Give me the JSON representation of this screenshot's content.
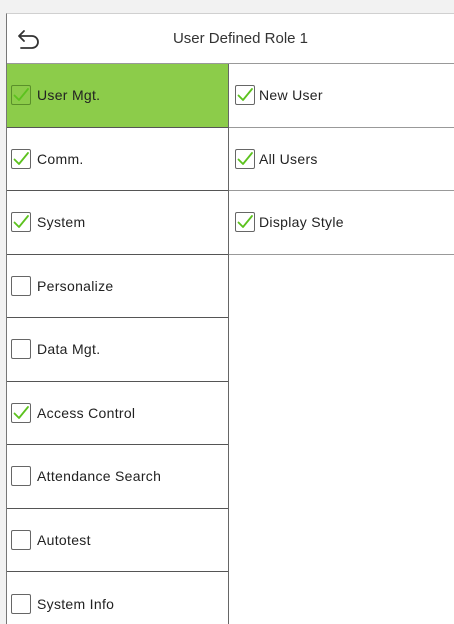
{
  "header": {
    "title": "User Defined Role 1",
    "back_icon": "back-arrow-icon"
  },
  "colors": {
    "selected_bg": "#8ccc4a",
    "check": "#5cc21e"
  },
  "left_menu": {
    "items": [
      {
        "label": "User Mgt.",
        "checked": true,
        "selected": true
      },
      {
        "label": "Comm.",
        "checked": true,
        "selected": false
      },
      {
        "label": "System",
        "checked": true,
        "selected": false
      },
      {
        "label": "Personalize",
        "checked": false,
        "selected": false
      },
      {
        "label": "Data Mgt.",
        "checked": false,
        "selected": false
      },
      {
        "label": "Access Control",
        "checked": true,
        "selected": false
      },
      {
        "label": "Attendance Search",
        "checked": false,
        "selected": false
      },
      {
        "label": "Autotest",
        "checked": false,
        "selected": false
      },
      {
        "label": "System Info",
        "checked": false,
        "selected": false
      }
    ]
  },
  "right_menu": {
    "items": [
      {
        "label": "New User",
        "checked": true
      },
      {
        "label": "All Users",
        "checked": true
      },
      {
        "label": "Display Style",
        "checked": true
      }
    ]
  }
}
